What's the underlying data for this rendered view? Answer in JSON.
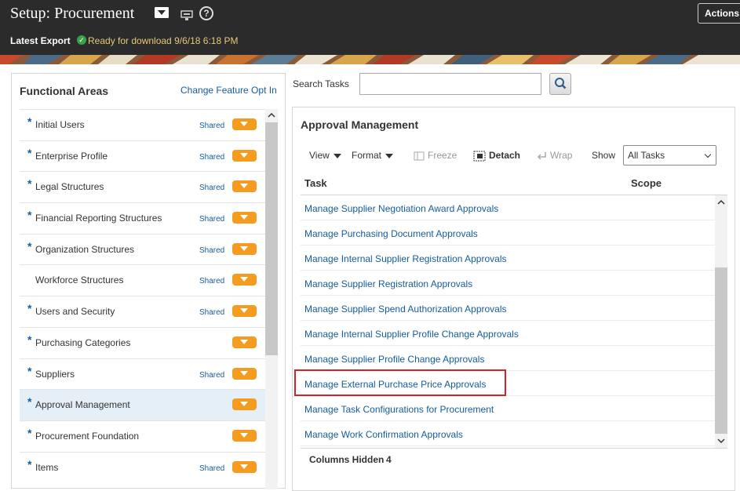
{
  "header": {
    "title": "Setup: Procurement",
    "actions_label": "Actions",
    "help_glyph": "?",
    "export_label": "Latest Export",
    "export_status": "Ready for download 9/6/18 6:18 PM"
  },
  "functional_areas": {
    "title": "Functional Areas",
    "change_link": "Change Feature Opt In",
    "items": [
      {
        "label": "Initial Users",
        "required": "*",
        "shared": "Shared"
      },
      {
        "label": "Enterprise Profile",
        "required": "*",
        "shared": "Shared"
      },
      {
        "label": "Legal Structures",
        "required": "*",
        "shared": "Shared"
      },
      {
        "label": "Financial Reporting Structures",
        "required": "*",
        "shared": "Shared"
      },
      {
        "label": "Organization Structures",
        "required": "*",
        "shared": "Shared"
      },
      {
        "label": "Workforce Structures",
        "required": "",
        "shared": "Shared"
      },
      {
        "label": "Users and Security",
        "required": "*",
        "shared": "Shared"
      },
      {
        "label": "Purchasing Categories",
        "required": "*",
        "shared": ""
      },
      {
        "label": "Suppliers",
        "required": "*",
        "shared": "Shared"
      },
      {
        "label": "Approval Management",
        "required": "*",
        "shared": ""
      },
      {
        "label": "Procurement Foundation",
        "required": "*",
        "shared": ""
      },
      {
        "label": "Items",
        "required": "*",
        "shared": "Shared"
      }
    ]
  },
  "search": {
    "label": "Search Tasks",
    "value": ""
  },
  "approval": {
    "title": "Approval Management",
    "toolbar": {
      "view": "View",
      "format": "Format",
      "freeze": "Freeze",
      "detach": "Detach",
      "wrap": "Wrap",
      "show_label": "Show",
      "show_value": "All Tasks"
    },
    "columns": [
      "Task",
      "Scope"
    ],
    "tasks": [
      "Manage Supplier Negotiation Award Approvals",
      "Manage Purchasing Document Approvals",
      "Manage Internal Supplier Registration Approvals",
      "Manage Supplier Registration Approvals",
      "Manage Supplier Spend Authorization Approvals",
      "Manage Internal Supplier Profile Change Approvals",
      "Manage Supplier Profile Change Approvals",
      "Manage External Purchase Price Approvals",
      "Manage Task Configurations for Procurement",
      "Manage Work Confirmation Approvals"
    ],
    "columns_hidden_label": "Columns Hidden",
    "columns_hidden_count": "4"
  },
  "colors": {
    "header_bg": "#2b2b2b",
    "link": "#145c9e",
    "accent_orange": "#f39c1f",
    "selected_row": "#e4eff8",
    "highlight_box": "#d0242b"
  }
}
